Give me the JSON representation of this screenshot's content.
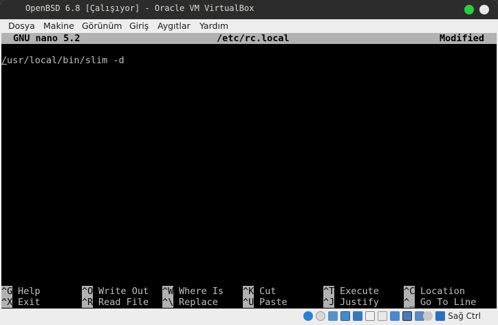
{
  "window": {
    "title": "OpenBSD 6.8 [Çalışıyor] - Oracle VM VirtualBox"
  },
  "menubar": {
    "items": [
      "Dosya",
      "Makine",
      "Görünüm",
      "Giriş",
      "Aygıtlar",
      "Yardım"
    ]
  },
  "nano": {
    "version": "GNU nano 5.2",
    "filename": "/etc/rc.local",
    "state": "Modified",
    "content_first_char": "/",
    "content_rest": "usr/local/bin/slim -d"
  },
  "shortcuts": [
    {
      "key": "^G",
      "label": "Help"
    },
    {
      "key": "^X",
      "label": "Exit"
    },
    {
      "key": "^O",
      "label": "Write Out"
    },
    {
      "key": "^R",
      "label": "Read File"
    },
    {
      "key": "^W",
      "label": "Where Is"
    },
    {
      "key": "^\\",
      "label": "Replace"
    },
    {
      "key": "^K",
      "label": "Cut"
    },
    {
      "key": "^U",
      "label": "Paste"
    },
    {
      "key": "^T",
      "label": "Execute"
    },
    {
      "key": "^J",
      "label": "Justify"
    },
    {
      "key": "^C",
      "label": "Location"
    },
    {
      "key": "^_",
      "label": "Go To Line"
    }
  ],
  "statusbar": {
    "icons": [
      "hard-disk-icon",
      "optical-drive-icon",
      "audio-icon",
      "network-icon",
      "usb-icon",
      "shared-folders-icon",
      "display-icon",
      "recording-icon",
      "cpu-icon",
      "vm-icon",
      "mouse-integration-icon",
      "keyboard-capture-icon"
    ],
    "host_key": "Sağ Ctrl"
  },
  "colors": {
    "titlebar_bg": "#2c2c2c",
    "terminal_bg": "#000000",
    "nano_bar": "#b2b2b2",
    "min_button": "#2ecc40"
  }
}
